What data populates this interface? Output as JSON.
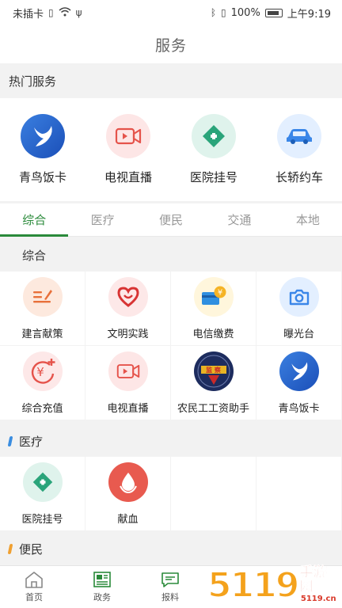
{
  "status_bar": {
    "left": "未插卡",
    "battery": "100%",
    "time": "上午9:19"
  },
  "header": {
    "title": "服务"
  },
  "hot": {
    "title": "热门服务",
    "items": [
      {
        "label": "青鸟饭卡",
        "icon": "bird-icon"
      },
      {
        "label": "电视直播",
        "icon": "video-icon"
      },
      {
        "label": "医院挂号",
        "icon": "medical-cross-icon"
      },
      {
        "label": "长轿约车",
        "icon": "car-icon"
      }
    ]
  },
  "tabs": [
    {
      "label": "综合",
      "active": true
    },
    {
      "label": "医疗"
    },
    {
      "label": "便民"
    },
    {
      "label": "交通"
    },
    {
      "label": "本地"
    }
  ],
  "sections": {
    "zonghe": {
      "title": "综合",
      "items": [
        {
          "label": "建言献策",
          "icon": "pen-icon"
        },
        {
          "label": "文明实践",
          "icon": "heart-icon"
        },
        {
          "label": "电信缴费",
          "icon": "card-yuan-icon"
        },
        {
          "label": "曝光台",
          "icon": "camera-icon"
        },
        {
          "label": "综合充值",
          "icon": "yuan-plus-icon"
        },
        {
          "label": "电视直播",
          "icon": "video-icon"
        },
        {
          "label": "农民工工资助手",
          "icon": "badge-icon",
          "badge_text": "监 察"
        },
        {
          "label": "青鸟饭卡",
          "icon": "bird-icon"
        }
      ]
    },
    "yiliao": {
      "title": "医疗",
      "marker_color": "#3a8de0",
      "items": [
        {
          "label": "医院挂号",
          "icon": "medical-cross-icon"
        },
        {
          "label": "献血",
          "icon": "blood-drop-icon"
        }
      ]
    },
    "bianmin": {
      "title": "便民",
      "marker_color": "#f0a030"
    }
  },
  "bottom_nav": [
    {
      "label": "首页",
      "icon": "home-icon"
    },
    {
      "label": "政务",
      "icon": "newspaper-icon"
    },
    {
      "label": "报料",
      "icon": "chat-icon"
    }
  ],
  "watermark": {
    "number": "5119",
    "big": "手游网",
    "small": "5119.cn"
  }
}
